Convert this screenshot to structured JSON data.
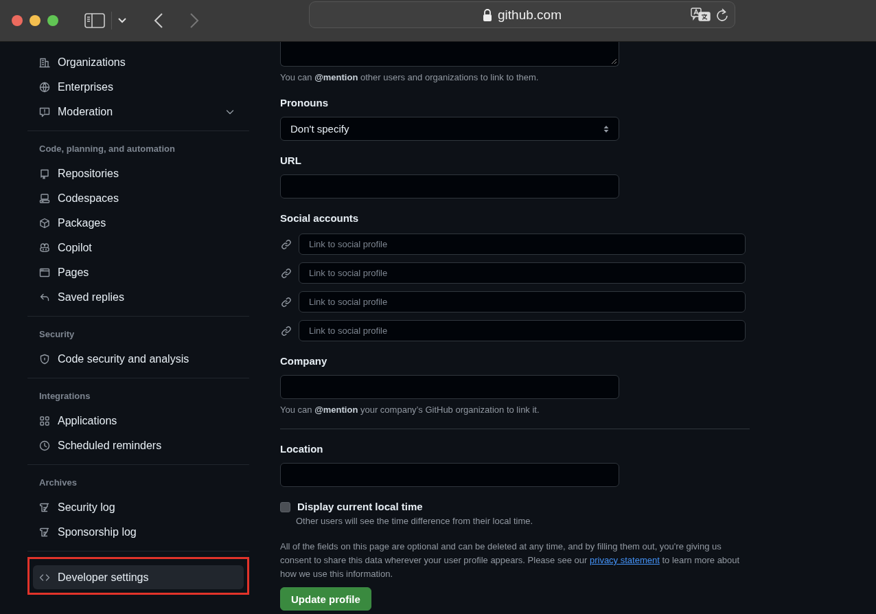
{
  "browser": {
    "address": "github.com"
  },
  "sidebar": {
    "groups": [
      {
        "items": [
          {
            "label": "Organizations",
            "kind": "link",
            "selected": false,
            "outlined": false
          },
          {
            "label": "Enterprises",
            "kind": "link",
            "selected": false,
            "outlined": false
          },
          {
            "label": "Moderation",
            "kind": "collapsible",
            "selected": false,
            "outlined": false
          }
        ]
      },
      {
        "heading": "Code, planning, and automation",
        "items": [
          {
            "label": "Repositories",
            "kind": "link",
            "selected": false,
            "outlined": false
          },
          {
            "label": "Codespaces",
            "kind": "link",
            "selected": false,
            "outlined": false
          },
          {
            "label": "Packages",
            "kind": "link",
            "selected": false,
            "outlined": false
          },
          {
            "label": "Copilot",
            "kind": "link",
            "selected": false,
            "outlined": false
          },
          {
            "label": "Pages",
            "kind": "link",
            "selected": false,
            "outlined": false
          },
          {
            "label": "Saved replies",
            "kind": "link",
            "selected": false,
            "outlined": false
          }
        ]
      },
      {
        "heading": "Security",
        "items": [
          {
            "label": "Code security and analysis",
            "kind": "link",
            "selected": false,
            "outlined": false
          }
        ]
      },
      {
        "heading": "Integrations",
        "items": [
          {
            "label": "Applications",
            "kind": "link",
            "selected": false,
            "outlined": false
          },
          {
            "label": "Scheduled reminders",
            "kind": "link",
            "selected": false,
            "outlined": false
          }
        ]
      },
      {
        "heading": "Archives",
        "items": [
          {
            "label": "Security log",
            "kind": "link",
            "selected": false,
            "outlined": false
          },
          {
            "label": "Sponsorship log",
            "kind": "link",
            "selected": false,
            "outlined": false
          }
        ]
      },
      {
        "items": [
          {
            "label": "Developer settings",
            "kind": "link",
            "selected": true,
            "outlined": true
          }
        ]
      }
    ]
  },
  "form": {
    "bio": {
      "hint": "You can **@mention** other users and organizations to link to them."
    },
    "pronouns": {
      "label": "Pronouns",
      "value": "Don't specify"
    },
    "url": {
      "label": "URL"
    },
    "social_accounts": {
      "label": "Social accounts",
      "links": [
        {
          "placeholder": "Link to social profile"
        },
        {
          "placeholder": "Link to social profile"
        },
        {
          "placeholder": "Link to social profile"
        },
        {
          "placeholder": "Link to social profile"
        }
      ]
    },
    "company": {
      "label": "Company",
      "hint": "You can **@mention** your company’s GitHub organization to link it."
    },
    "location": {
      "label": "Location"
    },
    "local_time": {
      "label": "Display current local time",
      "checked": false,
      "hint": "Other users will see the time difference from their local time."
    },
    "notice": {
      "text": "All of the fields on this page are optional and can be deleted at any time, and by filling them out, you're giving us consent to share this data wherever your user profile appears. Please see our",
      "link": "privacy statement",
      "after": "to learn more about how we use this information."
    },
    "submit": "Update profile"
  }
}
